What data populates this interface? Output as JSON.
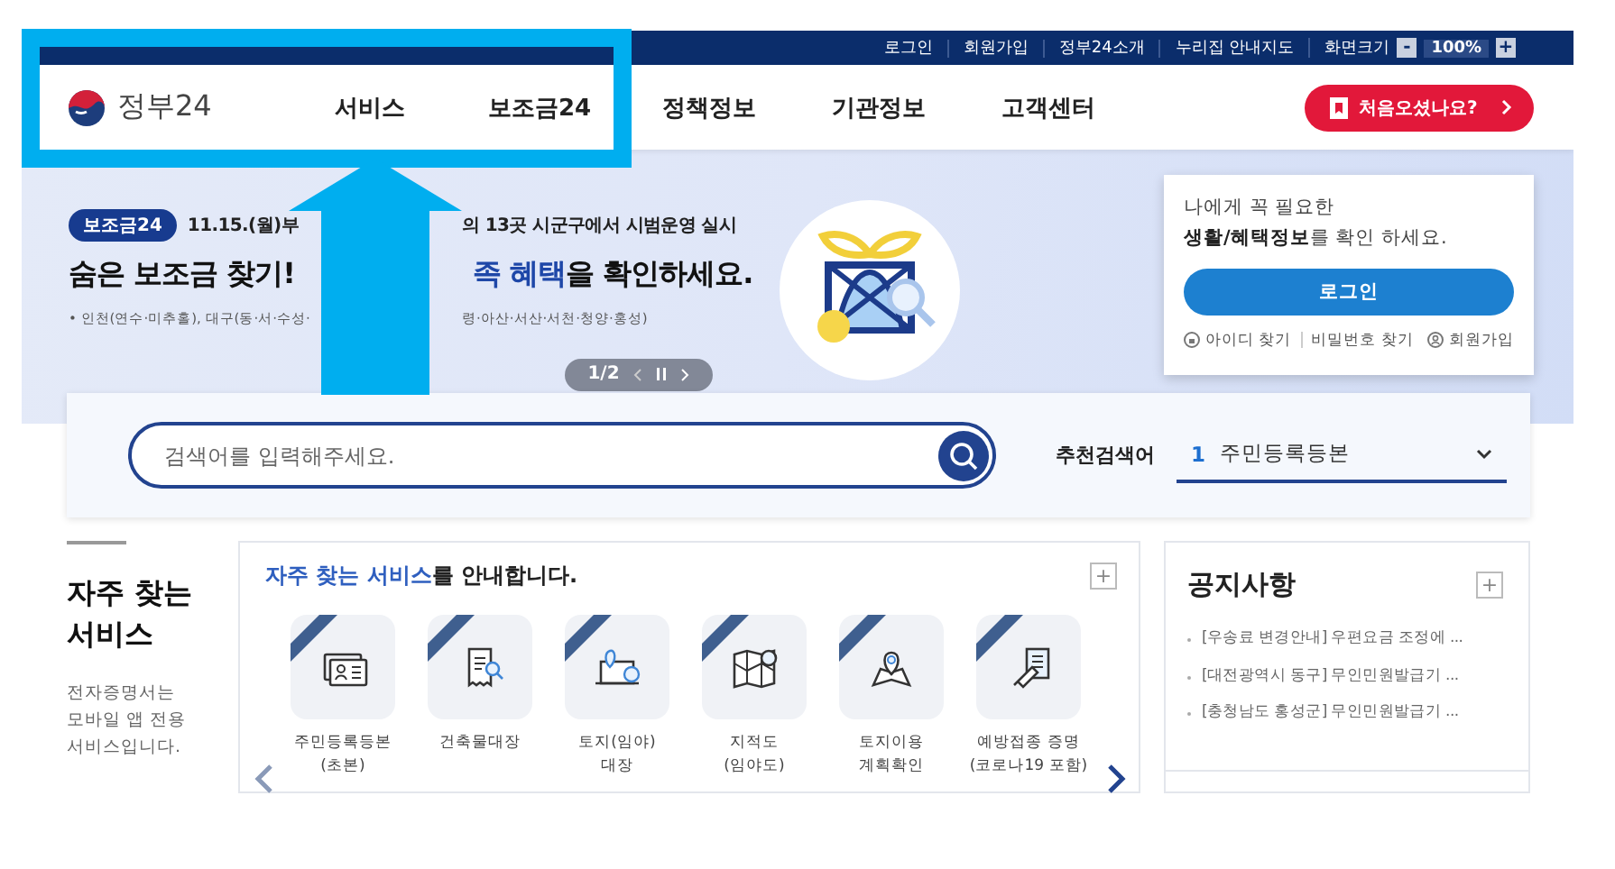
{
  "utility_links": [
    "로그인",
    "회원가입",
    "정부24소개",
    "누리집 안내지도"
  ],
  "font_size": {
    "label": "화면크기",
    "minus": "-",
    "value": "100%",
    "plus": "+"
  },
  "logo": {
    "text": "정부24"
  },
  "nav": [
    {
      "label": "서비스"
    },
    {
      "label": "보조금24"
    },
    {
      "label": "정책정보"
    },
    {
      "label": "기관정보"
    },
    {
      "label": "고객센터"
    }
  ],
  "first_visit_button": {
    "label": "처음오셨나요?"
  },
  "banner": {
    "badge": "보조금24",
    "notice_left": "11.15.(월)부",
    "notice_right": "의 13곳 시군구에서 시범운영 실시",
    "headline_left": "숨은 보조금 찾기!",
    "headline_right": "**족 혜택**을 확인하세요.",
    "sub_left": "• 인천(연수·미추홀), 대구(동·서·수성·",
    "sub_right": "령·아산·서산·서천·청양·홍성)",
    "pager": "1/2"
  },
  "login_card": {
    "line_1": "나에게 꼭 필요한",
    "line_2": "**생활/혜택정보**를 확인 하세요.",
    "button": "로그인",
    "links": [
      "아이디 찾기",
      "비밀번호 찾기",
      "회원가입"
    ]
  },
  "search": {
    "placeholder": "검색어를 입력해주세요.",
    "recommended_label": "추천검색어",
    "recommended_rank": "1",
    "recommended_term": "주민등록등본"
  },
  "services": {
    "side_title": "자주 찾는\n서비스",
    "side_text": "전자증명서는\n모바일 앱 전용\n서비스입니다.",
    "title": "**자주 찾는 서비스**를 안내합니다.",
    "more": "+",
    "items": [
      {
        "label": "주민등록등본\n(초본)"
      },
      {
        "label": "건축물대장"
      },
      {
        "label": "토지(임야)\n대장"
      },
      {
        "label": "지적도\n(임야도)"
      },
      {
        "label": "토지이용\n계획확인"
      },
      {
        "label": "예방접종 증명\n(코로나19 포함)"
      }
    ]
  },
  "notices": {
    "title": "공지사항",
    "more": "+",
    "items": [
      "[우송료 변경안내] 우편요금 조정에 ...",
      "[대전광역시 동구] 무인민원발급기 ...",
      "[충청남도 홍성군] 무인민원발급기 ..."
    ]
  }
}
